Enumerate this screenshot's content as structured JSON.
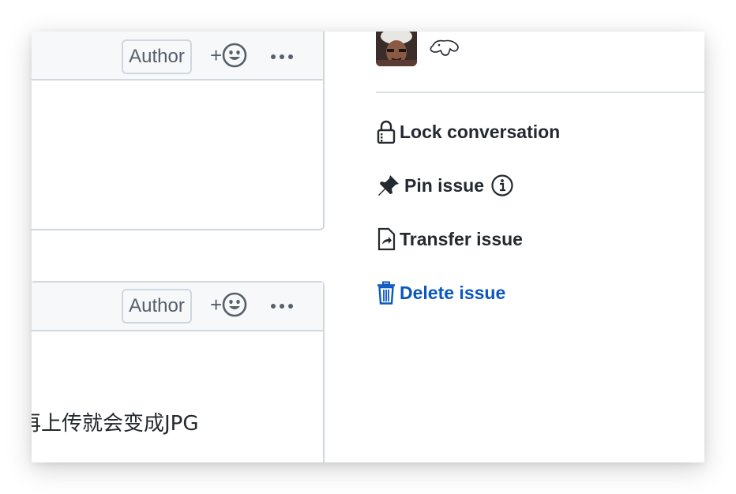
{
  "comments": [
    {
      "author_badge": "Author",
      "reaction_plus": "+",
      "body_text": ""
    },
    {
      "author_badge": "Author",
      "reaction_plus": "+",
      "body_text": "再上传就会变成JPG"
    }
  ],
  "sidebar": {
    "actions": {
      "lock": "Lock conversation",
      "pin": "Pin issue",
      "transfer": "Transfer issue",
      "delete": "Delete issue"
    }
  },
  "colors": {
    "delete_link": "#0a57c2",
    "border": "#d0d7de",
    "header_bg": "#f6f8fa"
  },
  "icons": [
    "smiley-icon",
    "kebab-icon",
    "lock-icon",
    "pin-icon",
    "info-icon",
    "transfer-icon",
    "trash-icon"
  ]
}
